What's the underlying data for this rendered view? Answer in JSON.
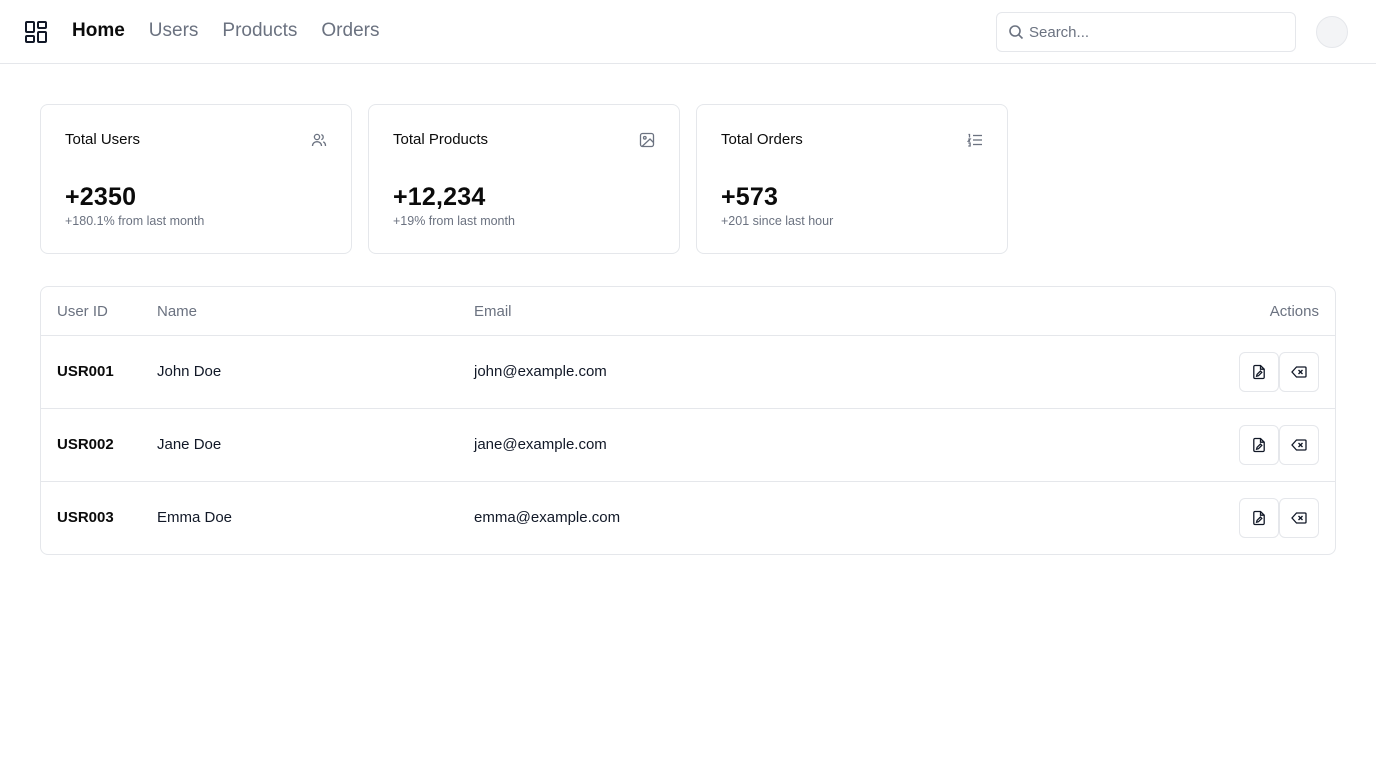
{
  "header": {
    "logo_icon": "layout-grid-icon",
    "nav": [
      {
        "label": "Home",
        "active": true
      },
      {
        "label": "Users",
        "active": false
      },
      {
        "label": "Products",
        "active": false
      },
      {
        "label": "Orders",
        "active": false
      }
    ],
    "search": {
      "placeholder": "Search...",
      "value": "",
      "icon": "search-icon"
    },
    "avatar_icon": "user-avatar"
  },
  "stats": [
    {
      "title": "Total Users",
      "value": "+2350",
      "sub": "+180.1% from last month",
      "icon": "users-icon"
    },
    {
      "title": "Total Products",
      "value": "+12,234",
      "sub": "+19% from last month",
      "icon": "image-icon"
    },
    {
      "title": "Total Orders",
      "value": "+573",
      "sub": "+201 since last hour",
      "icon": "list-ordered-icon"
    }
  ],
  "table": {
    "columns": [
      "User ID",
      "Name",
      "Email",
      "Actions"
    ],
    "rows": [
      {
        "id": "USR001",
        "name": "John Doe",
        "email": "john@example.com"
      },
      {
        "id": "USR002",
        "name": "Jane Doe",
        "email": "jane@example.com"
      },
      {
        "id": "USR003",
        "name": "Emma Doe",
        "email": "emma@example.com"
      }
    ],
    "action_icons": [
      "file-edit-icon",
      "delete-icon"
    ]
  },
  "colors": {
    "text": "#0b0b0b",
    "muted": "#6b7280",
    "border": "#e5e7eb"
  }
}
